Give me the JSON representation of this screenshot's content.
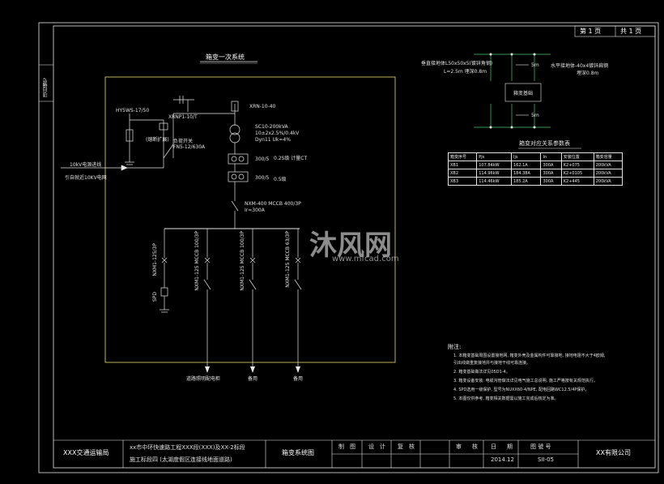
{
  "page": {
    "side_tab": "项目编号"
  },
  "sheet": {
    "page_no": "第 1 页",
    "page_total": "共 1 页"
  },
  "primary_title": "箱变一次系统",
  "components": {
    "surge_arrester": "HY5WS-17/50",
    "fuse": "XRNP1-10/T",
    "fuse_status": "(熔断扩展)",
    "load_switch": "负荷开关",
    "load_switch_model": "FN5-12/630A",
    "incoming_label": "10kV电源进线",
    "incoming_from": "引自就近10KV电网",
    "hv_fuse": "XRN-10-40",
    "transformer": "SC10-200kVA",
    "transformer_ratio": "10±2x2.5%/0.4kV",
    "transformer_vector": "Dyn11 Uk=4%",
    "ct1_ratio": "300/5",
    "ct1_label": "0.2S级 计量CT",
    "ct2_ratio": "300/5",
    "ct2_label": "0.5级",
    "main_breaker": "NXM-400 MCCB 400/3P",
    "main_breaker_ir": "Ir=300A",
    "feeder1": "NXM1-125/3P",
    "feeder1_disc": "SPD",
    "feeder2": "NXM1-125 MCCB 100/3P",
    "feeder3": "NXM1-125 MCCB 100/3P",
    "feeder4": "NXM1-125 MCCB 63/3P"
  },
  "outputs": {
    "out1": "道路照明配电柜",
    "out2": "备用",
    "out3": "备用"
  },
  "grounding": {
    "top_label": "垂直接地体L50x50x5(镀锌角钢)",
    "top_sub": "L=2.5m 埋深0.8m",
    "right_label": "水平接地体-40x4镀锌扁钢",
    "right_sub": "埋深0.8m",
    "box": "箱变基础",
    "dim1": "5m",
    "dim2": "5m"
  },
  "table": {
    "title": "箱变对应关系参数表",
    "headers": [
      "箱变序号",
      "Pjs",
      "Ijs",
      "In",
      "安装位置",
      "箱变容量"
    ],
    "rows": [
      [
        "XB1",
        "107.84kW",
        "162.1A",
        "300A",
        "K2+075",
        "200kVA"
      ],
      [
        "XB2",
        "114.96kW",
        "184.38A",
        "300A",
        "K2+0105",
        "200kVA"
      ],
      [
        "XB3",
        "114.46kW",
        "185.2A",
        "300A",
        "K2+445",
        "200kVA"
      ]
    ]
  },
  "notes": {
    "heading": "附注:",
    "lines": [
      "1. 本箱变基础周围设置接地网, 箱变外壳及金属构件可靠接地, 接地电阻不大于4欧姆,",
      "   引出线做重复接地并与接地干线可靠连接。",
      "2. 箱变基础做法详见05D1-4。",
      "3. 箱变设备安装: 电缆沟管做法详见电气施工总说明, 施工严格按有关规范执行。",
      "4. SPD选用一级保护, 型号为NUXX60-4/NPE, 配电回路WC12.5/4P保护。",
      "5. 本图仅供参考, 箱变相关数据需以施工完成后核定为准。"
    ]
  },
  "titleblock": {
    "org": "XXX交通运输局",
    "project_line1": "xx市中环快速路工程XXX段(XXX)及XX-2标段",
    "project_line2": "施工标段四 (太湖度假区连接线地面道路)",
    "drawing_title": "箱变系统图",
    "role1": "制",
    "role2": "图",
    "role3": "设",
    "role4": "计",
    "role5": "复",
    "role6": "核",
    "role7": "审",
    "role8": "核",
    "date_label": "日",
    "date_label2": "期",
    "date_value": "2014.12",
    "drawing_no_label": "图 號 号",
    "drawing_no": "SII-05",
    "company": "XX有限公司"
  },
  "watermark": {
    "brand": "沐风网",
    "url": "www.mfcad.com"
  },
  "colors": {
    "bg": "#000000",
    "line": "#e6e6e6",
    "frame": "#ffffff",
    "yellow": "#e8e070",
    "green": "#48c870",
    "blue": "#5a9bd8",
    "red": "#e05050"
  }
}
